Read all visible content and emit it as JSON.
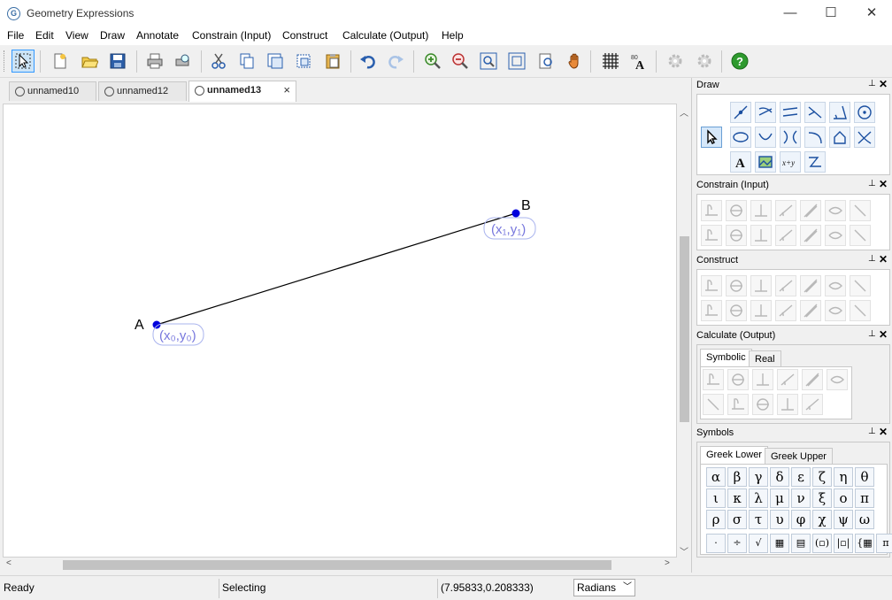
{
  "window": {
    "title": "Geometry Expressions",
    "minimize": "—",
    "maximize": "☐",
    "close": "✕"
  },
  "menu": [
    "File",
    "Edit",
    "View",
    "Draw",
    "Annotate",
    "Constrain (Input)",
    "Construct",
    "Calculate (Output)",
    "Help"
  ],
  "tabs": [
    {
      "label": "unnamed10",
      "active": false
    },
    {
      "label": "unnamed12",
      "active": false
    },
    {
      "label": "unnamed13",
      "active": true,
      "close": "×"
    }
  ],
  "canvas": {
    "point_a": {
      "label": "A",
      "coord": "(x₀,y₀)"
    },
    "point_b": {
      "label": "B",
      "coord": "(x₁,y₁)"
    },
    "line_color": "#000000",
    "point_color": "#0000dd",
    "coord_color": "#7777dd"
  },
  "panels": {
    "draw": {
      "title": "Draw",
      "pin": "⊥",
      "close": "✕"
    },
    "constrain": {
      "title": "Constrain (Input)",
      "pin": "⊥",
      "close": "✕"
    },
    "construct": {
      "title": "Construct",
      "pin": "⊥",
      "close": "✕"
    },
    "calculate": {
      "title": "Calculate (Output)",
      "pin": "⊥",
      "close": "✕",
      "tabs": [
        "Symbolic",
        "Real"
      ]
    },
    "symbols": {
      "title": "Symbols",
      "pin": "⊥",
      "close": "✕",
      "tabs": [
        "Greek Lower",
        "Greek Upper"
      ],
      "greek": [
        "α",
        "β",
        "γ",
        "δ",
        "ε",
        "ζ",
        "η",
        "θ",
        "ι",
        "κ",
        "λ",
        "μ",
        "ν",
        "ξ",
        "ο",
        "π",
        "ρ",
        "σ",
        "τ",
        "υ",
        "φ",
        "χ",
        "ψ",
        "ω"
      ],
      "ops": [
        "·",
        "÷",
        "√",
        "▦",
        "▤",
        "(▫)",
        "|▫|",
        "{▦",
        "π"
      ]
    }
  },
  "status": {
    "ready": "Ready",
    "mode": "Selecting",
    "coords": "(7.95833,0.208333)",
    "angle_unit": "Radians"
  }
}
